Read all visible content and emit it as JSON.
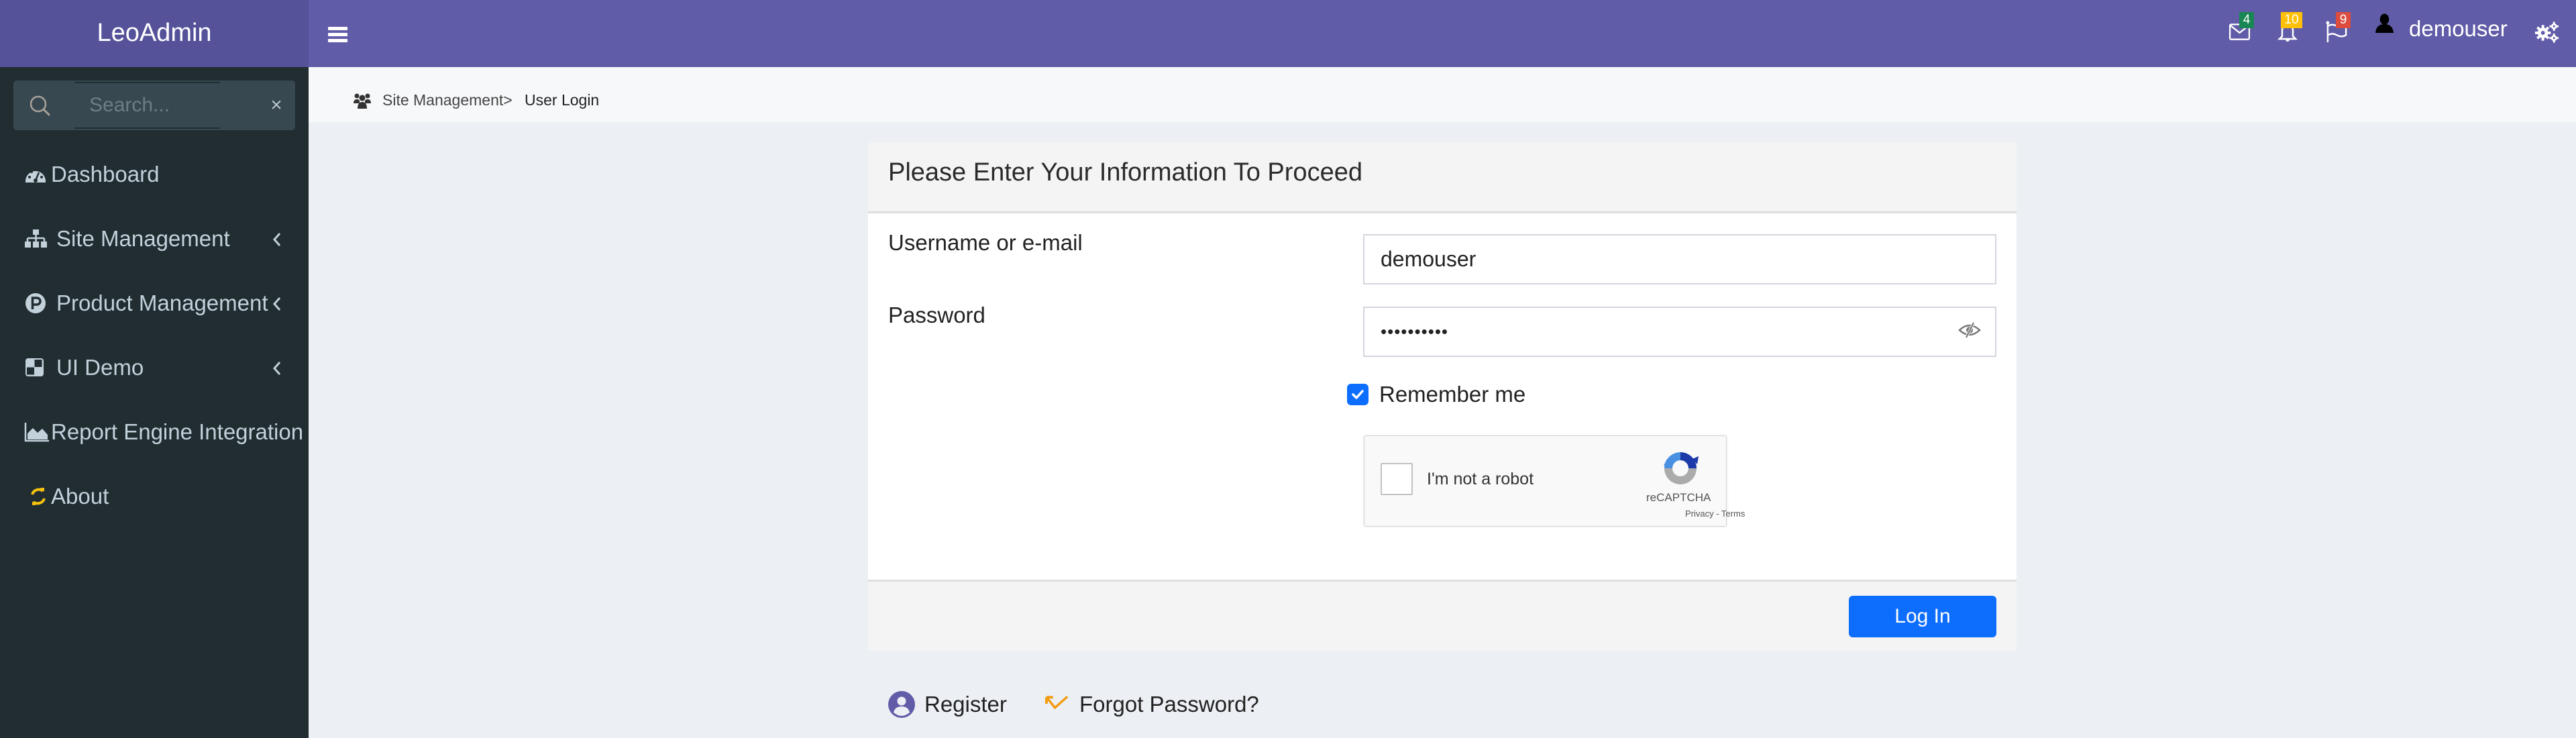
{
  "app": {
    "brand": "LeoAdmin"
  },
  "sidebar": {
    "search": {
      "placeholder": "Search...",
      "value": "",
      "clear_label": "×"
    },
    "items": [
      {
        "label": "Dashboard",
        "icon": "dashboard-gauge-icon",
        "has_children": false
      },
      {
        "label": "Site Management",
        "icon": "sitemap-icon",
        "has_children": true
      },
      {
        "label": "Product Management",
        "icon": "product-p-circle-icon",
        "has_children": true
      },
      {
        "label": "UI Demo",
        "icon": "ui-demo-squares-icon",
        "has_children": true
      },
      {
        "label": "Report Engine Integration",
        "icon": "area-chart-icon",
        "has_children": false
      },
      {
        "label": "About",
        "icon": "sync-icon",
        "has_children": false
      }
    ]
  },
  "navbar": {
    "messages": {
      "icon": "envelope-icon",
      "count": "4",
      "color": "#198754"
    },
    "notifications": {
      "icon": "bell-icon",
      "count": "10",
      "color": "#ffc107"
    },
    "tasks": {
      "icon": "flag-icon",
      "count": "9",
      "color": "#dc4c3f"
    },
    "user": {
      "icon": "user-icon",
      "name": "demouser"
    },
    "settings": {
      "icon": "gears-icon"
    }
  },
  "breadcrumb": {
    "icon": "users-icon",
    "parent": "Site Management>",
    "current": "User Login"
  },
  "form": {
    "title": "Please Enter Your Information To Proceed",
    "username": {
      "label": "Username or e-mail",
      "value": "demouser"
    },
    "password": {
      "label": "Password",
      "value": "••••••••••",
      "toggle_icon": "eye-slash-icon"
    },
    "remember": {
      "label": "Remember me",
      "checked": true
    },
    "captcha": {
      "label": "I'm not a robot",
      "brand": "reCAPTCHA",
      "links": "Privacy - Terms",
      "checked": false
    },
    "submit_label": "Log In"
  },
  "links": {
    "register": "Register",
    "forgot": "Forgot Password?"
  },
  "colors": {
    "brand_bg": "#55529a",
    "navbar_bg": "#615ca8",
    "sidebar_bg": "#222d32",
    "primary": "#0d6efd",
    "register_icon": "#615ca8",
    "forgot_icon": "#f39c12",
    "about_icon": "#f4c20d"
  }
}
